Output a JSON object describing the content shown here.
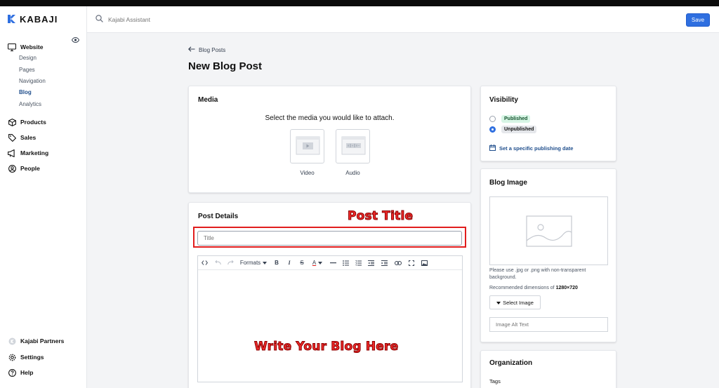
{
  "brand": {
    "name": "KABAJI"
  },
  "sidebar": {
    "website": {
      "label": "Website",
      "subs": [
        {
          "label": "Design"
        },
        {
          "label": "Pages"
        },
        {
          "label": "Navigation"
        },
        {
          "label": "Blog"
        },
        {
          "label": "Analytics"
        }
      ]
    },
    "items": [
      {
        "label": "Products",
        "icon": "box-icon"
      },
      {
        "label": "Sales",
        "icon": "tag-icon"
      },
      {
        "label": "Marketing",
        "icon": "megaphone-icon"
      },
      {
        "label": "People",
        "icon": "user-circle-icon"
      }
    ],
    "bottom": [
      {
        "label": "Kajabi Partners",
        "icon": "partner-icon"
      },
      {
        "label": "Settings",
        "icon": "gear-icon"
      },
      {
        "label": "Help",
        "icon": "question-icon"
      }
    ],
    "active": "Blog"
  },
  "header": {
    "search_placeholder": "Kajabi Assistant",
    "save_label": "Save"
  },
  "main": {
    "back_label": "Blog Posts",
    "page_title": "New Blog Post",
    "media": {
      "title": "Media",
      "prompt": "Select the media you would like to attach.",
      "options": [
        {
          "label": "Video"
        },
        {
          "label": "Audio"
        }
      ]
    },
    "post_details": {
      "title": "Post Details",
      "title_placeholder": "Title",
      "toolbar": {
        "formats_label": "Formats"
      }
    },
    "annotations": {
      "post_title": "Post Title",
      "write_blog": "Write Your Blog Here"
    }
  },
  "right": {
    "visibility": {
      "title": "Visibility",
      "options": [
        {
          "label": "Published",
          "selected": false
        },
        {
          "label": "Unpublished",
          "selected": true
        }
      ],
      "schedule_link": "Set a specific publishing date"
    },
    "blog_image": {
      "title": "Blog Image",
      "hint_1": "Please use .jpg or .png with non-transparent background.",
      "hint_2_prefix": "Recommended dimensions of ",
      "hint_2_value": "1280×720",
      "select_label": "Select Image",
      "alt_placeholder": "Image Alt Text"
    },
    "organization": {
      "title": "Organization",
      "tags_label": "Tags"
    }
  },
  "colors": {
    "accent": "#2f6fe0",
    "annotation": "#ef2a2a",
    "link": "#1f4e8c"
  }
}
